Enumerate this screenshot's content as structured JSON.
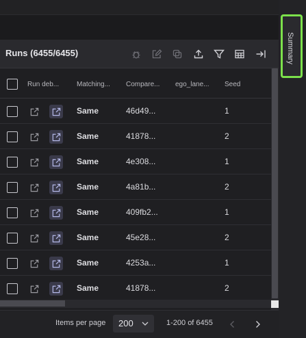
{
  "panel": {
    "title": "Runs (6455/6455)"
  },
  "toolbar": {
    "icons": [
      "debug-icon",
      "edit-icon",
      "copy-icon",
      "upload-icon",
      "filter-icon",
      "table-icon",
      "collapse-icon"
    ]
  },
  "table": {
    "columns": [
      "Run deb...",
      "Matching...",
      "Compare...",
      "ego_lane...",
      "Seed"
    ],
    "rows": [
      {
        "matching": "Same",
        "compare": "46d49...",
        "ego_lane": "",
        "seed": "1"
      },
      {
        "matching": "Same",
        "compare": "41878...",
        "ego_lane": "",
        "seed": "2"
      },
      {
        "matching": "Same",
        "compare": "4e308...",
        "ego_lane": "",
        "seed": "1"
      },
      {
        "matching": "Same",
        "compare": "4a81b...",
        "ego_lane": "",
        "seed": "2"
      },
      {
        "matching": "Same",
        "compare": "409fb2...",
        "ego_lane": "",
        "seed": "1"
      },
      {
        "matching": "Same",
        "compare": "45e28...",
        "ego_lane": "",
        "seed": "2"
      },
      {
        "matching": "Same",
        "compare": "4253a...",
        "ego_lane": "",
        "seed": "1"
      },
      {
        "matching": "Same",
        "compare": "41878...",
        "ego_lane": "",
        "seed": "2"
      }
    ]
  },
  "footer": {
    "items_per_page_label": "Items per page",
    "page_size": "200",
    "range_text": "1-200 of 6455"
  },
  "side": {
    "summary_label": "Summary"
  },
  "colors": {
    "highlight": "#7ce14b",
    "background": "#1f1f22"
  }
}
